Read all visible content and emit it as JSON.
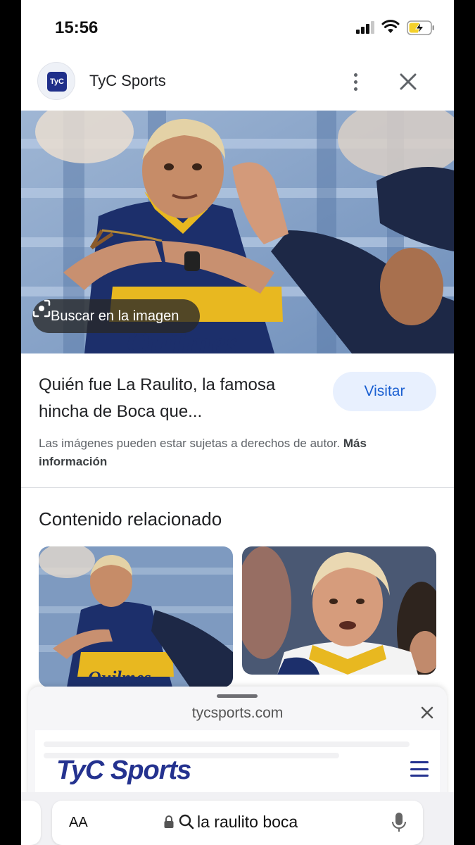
{
  "status_bar": {
    "time": "15:56",
    "icons": [
      "cellular-signal-icon",
      "wifi-icon",
      "battery-charging-icon"
    ]
  },
  "header": {
    "logo_text": "TyC",
    "site_name": "TyC Sports",
    "icons": [
      "more-vertical-icon",
      "close-icon"
    ]
  },
  "hero": {
    "lens_chip_label": "Buscar en la imagen",
    "icon": "lens-icon"
  },
  "result": {
    "title": "Quién fue La Raulito, la famosa hincha de Boca que...",
    "visit_label": "Visitar",
    "copyright_text": "Las imágenes pueden estar sujetas a derechos de autor.",
    "more_info": "Más información"
  },
  "related": {
    "heading": "Contenido relacionado"
  },
  "sheet": {
    "domain": "tycsports.com",
    "brand": "TyC Sports",
    "icons": [
      "close-icon",
      "hamburger-menu-icon"
    ]
  },
  "address_bar": {
    "text_size_label": "AA",
    "query": "la raulito boca",
    "icons": [
      "lock-icon",
      "search-icon",
      "microphone-icon"
    ]
  },
  "colors": {
    "accent": "#1a5fd1",
    "visit_bg": "#e8f0fe",
    "brand_blue": "#24328f",
    "jersey_blue": "#1c2f6b",
    "jersey_gold": "#e8b820"
  }
}
